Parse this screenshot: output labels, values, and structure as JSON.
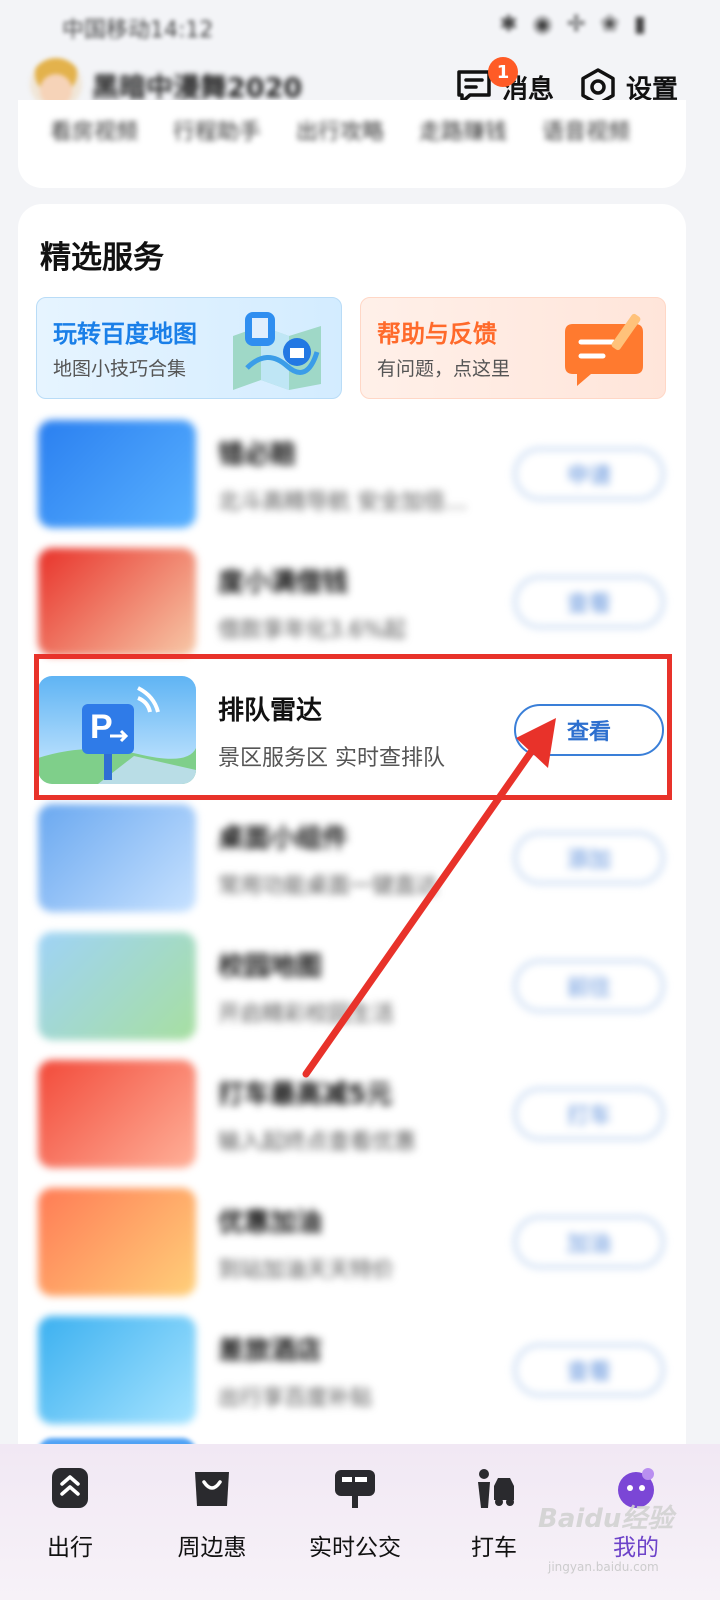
{
  "status_bar": {
    "carrier_time": "中国移动14:12"
  },
  "header": {
    "username": "黑暗中漫舞2020",
    "messages": {
      "label": "消息",
      "badge": "1"
    },
    "settings": {
      "label": "设置"
    }
  },
  "prev_section": {
    "items_text": "看房视频 行程助手 出行攻略 走路赚钱 语音视频"
  },
  "section": {
    "title": "精选服务",
    "promos": [
      {
        "title": "玩转百度地图",
        "subtitle": "地图小技巧合集"
      },
      {
        "title": "帮助与反馈",
        "subtitle": "有问题，点这里"
      }
    ],
    "items": [
      {
        "title": "错必赔",
        "subtitle": "北斗高精导航 安全加倍…",
        "button": "申请"
      },
      {
        "title": "度小满借钱",
        "subtitle": "借款享年化3.6%起",
        "button": "查看"
      },
      {
        "title": "排队雷达",
        "subtitle": "景区服务区 实时查排队",
        "button": "查看"
      },
      {
        "title": "桌面小组件",
        "subtitle": "常用功能桌面一键直达",
        "button": "添加"
      },
      {
        "title": "校园地图",
        "subtitle": "开启精彩校园生活",
        "button": "前往"
      },
      {
        "title": "打车最高减5元",
        "subtitle": "输入起终点查看优惠",
        "button": "打车"
      },
      {
        "title": "优惠加油",
        "subtitle": "到站加油天天特价",
        "button": "加油"
      },
      {
        "title": "差旅酒店",
        "subtitle": "出行享百度补贴",
        "button": "查看"
      }
    ]
  },
  "bottom_nav": {
    "items": [
      {
        "label": "出行",
        "icon": "route-icon"
      },
      {
        "label": "周边惠",
        "icon": "shopping-bag-icon"
      },
      {
        "label": "实时公交",
        "icon": "bus-stop-icon"
      },
      {
        "label": "打车",
        "icon": "taxi-person-icon"
      },
      {
        "label": "我的",
        "icon": "avatar-icon"
      }
    ]
  },
  "watermark": {
    "text": "Baidu经验",
    "sub": "jingyan.baidu.com"
  },
  "colors": {
    "accent": "#3a7fd8",
    "highlight": "#e8322a",
    "badge": "#ff5b26",
    "active_tab": "#6d43c9"
  }
}
